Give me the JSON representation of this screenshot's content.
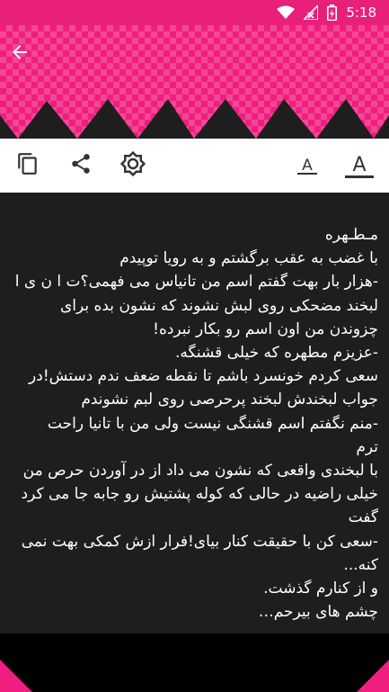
{
  "status_bar": {
    "time": "5:18",
    "icons": [
      "wifi-icon",
      "signal-icon",
      "battery-charging-icon"
    ]
  },
  "header": {
    "back_icon": "arrow-left-icon",
    "accent_color": "#f01e7e"
  },
  "toolbar": {
    "copy_icon": "copy-icon",
    "share_icon": "share-icon",
    "brightness_icon": "brightness-icon",
    "font_decrease_label": "A",
    "font_increase_label": "A"
  },
  "story": {
    "text": "مـطـهره\nبا غضب به عقب برگشتم و به رویا توپیدم\n-هزار بار بهت گفتم اسم من تانیاس می فهمی؟ت ا ن ی ا\nلبخند مضحکی روی لبش نشوند که نشون بده برای\nچزوندن من اون اسم رو بکار نبرده!\n-عزیزم مطهره که خیلی قشنگه.\nسعی کردم خونسرد باشم تا نقطه ضعف ندم دستش!در\nجواب لبخندش لبخند پرحرصی روی لبم نشوندم\n-منم نگفتم اسم قشنگی نیست ولی من با تانیا راحت\nترم\nبا لبخندی واقعی که نشون می داد از در آوردن حرص من\nخیلی راضیه در حالی که کوله پشتیش رو جابه جا می کرد\nگفت\n-سعی کن با حقیقت کنار بیای!فرار ازش کمکی بهت نمی\nکنه...\nو از کنارم گذشت.\nچشم های بیرحم…"
  }
}
